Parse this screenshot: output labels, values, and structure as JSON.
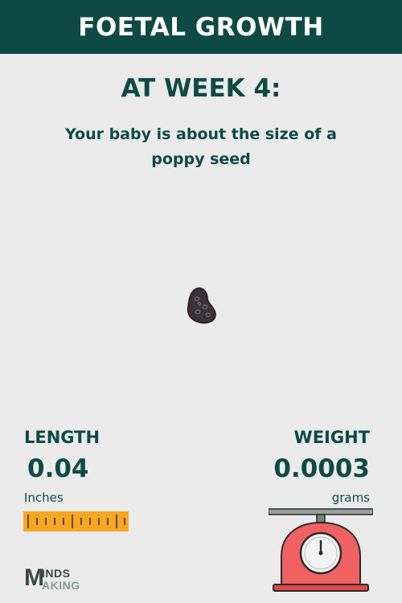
{
  "header": {
    "title": "FOETAL GROWTH"
  },
  "week": {
    "title": "AT WEEK 4:"
  },
  "size_comparison": {
    "text": "Your baby is about the size of a poppy seed",
    "object_icon": "poppy-seed-icon"
  },
  "length": {
    "label": "LENGTH",
    "value": "0.04",
    "unit": "Inches",
    "icon": "ruler-icon"
  },
  "weight": {
    "label": "WEIGHT",
    "value": "0.0003",
    "unit": "grams",
    "icon": "weighing-scale-icon"
  },
  "logo": {
    "mark": "M",
    "line1": "INDS",
    "line2": "AKING"
  },
  "colors": {
    "brand": "#0e4a44",
    "background": "#ebebeb",
    "ruler": "#f5a623",
    "scale": "#f06262",
    "seed": "#3a3236"
  }
}
